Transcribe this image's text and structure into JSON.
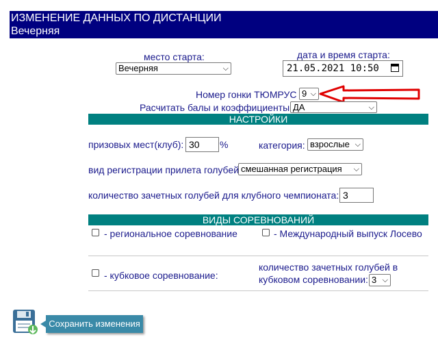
{
  "header": {
    "title": "ИЗМЕНЕНИЕ ДАННЫХ ПО ДИСТАНЦИИ",
    "subtitle": "Вечерняя"
  },
  "start_place": {
    "label": "место старта:",
    "value": "Вечерняя"
  },
  "start_datetime": {
    "label": "дата и время старта:",
    "value": "21.05.2021 10:50"
  },
  "race_number": {
    "label": "Номер гонки ТЮМРУС",
    "value": "9"
  },
  "calc_points": {
    "label": "Расчитать балы и коэффициенты",
    "value": "ДА"
  },
  "settings": {
    "title": "НАСТРОЙКИ",
    "prize_label": "призовых мест(клуб):",
    "prize_value": "30",
    "prize_unit": "%",
    "category_label": "категория:",
    "category_value": "взрослые",
    "registration_label": "вид регистрации прилета голубей:",
    "registration_value": "смешанная регистрация",
    "count_label": "количество зачетных голубей для клубного чемпионата:",
    "count_value": "3"
  },
  "competitions": {
    "title": "ВИДЫ СОРЕВНОВАНИЙ",
    "regional": "- региональное соревнование",
    "international": "- Международный выпуск Лосево",
    "cup": "- кубковое соревнование:",
    "cup_count_label_1": "количество зачетных голубей в",
    "cup_count_label_2": "кубковом соревновании:",
    "cup_count_value": "3"
  },
  "save_button": "Сохранить изменения",
  "colors": {
    "header_bg": "#000080",
    "bar_bg": "#008080",
    "arrow": "#e00000",
    "button_bg": "#3a8aa8"
  }
}
